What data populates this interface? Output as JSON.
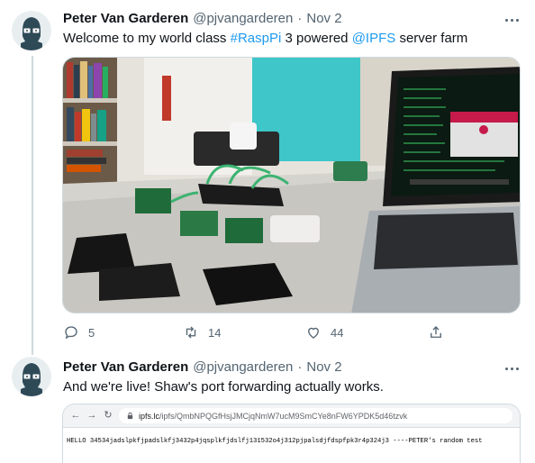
{
  "colors": {
    "accent": "#1d9bf0",
    "text": "#0f1419",
    "muted": "#536471",
    "border": "#cfd9de"
  },
  "tweets": [
    {
      "author_name": "Peter Van Garderen",
      "author_handle": "@pjvangarderen",
      "separator": "·",
      "date": "Nov 2",
      "text_1": "Welcome to my world class ",
      "hashtag": "#RaspPi",
      "text_2": " 3 powered ",
      "mention": "@IPFS",
      "text_3": " server farm",
      "media_icon": "photo-raspberry-pi-server-farm",
      "replies": "5",
      "retweets": "14",
      "likes": "44"
    },
    {
      "author_name": "Peter Van Garderen",
      "author_handle": "@pjvangarderen",
      "separator": "·",
      "date": "Nov 2",
      "text": "And we're live! Shaw's port forwarding actually works.",
      "browser": {
        "url_host": "ipfs.lc",
        "url_path": "/ipfs/QmbNPQGfHsjJMCjqNmW7ucM9SmCYe8nFW6YPDK5d46tzvk",
        "page_text": "HELLO 34534jadslpkfjpadslkfj3432p4jqsplkfjdslfj131532o4j312pjpalsdjfdspfpk3r4p324j3 ----PETER's random test"
      }
    }
  ]
}
